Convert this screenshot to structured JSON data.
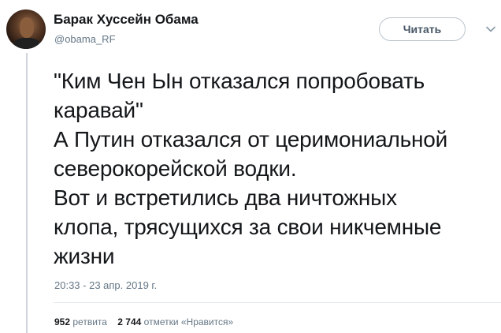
{
  "author": {
    "name": "Барак Хуссейн Обама",
    "handle": "@obama_RF"
  },
  "follow_button": {
    "label": "Читать"
  },
  "menu": {
    "icon": "chevron-down-icon"
  },
  "tweet": {
    "text": "\"Ким Чен Ын отказался попробовать\nкаравай\"\nА Путин отказался от церимониальной\nсеверокорейской водки.\nВот и встретились два ничтожных\nклопа, трясущихся за свои никчемные\nжизни",
    "timestamp": "20:33 - 23 апр. 2019 г."
  },
  "stats": {
    "retweets_count": "952",
    "retweets_label": "ретвита",
    "likes_count": "2 744",
    "likes_label": "отметки «Нравится»"
  },
  "colors": {
    "text": "#14171a",
    "secondary": "#657786",
    "border": "#b9c3cc"
  }
}
